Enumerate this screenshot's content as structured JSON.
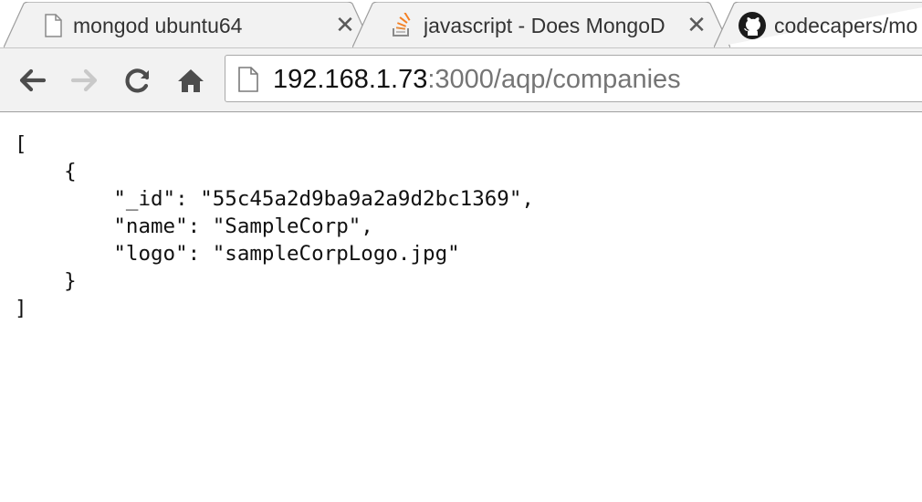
{
  "browser": {
    "tabs": [
      {
        "title": "mongod ubuntu64",
        "icon": "document-icon",
        "close": "✕"
      },
      {
        "title": "javascript - Does MongoD",
        "icon": "stackoverflow-icon",
        "close": "✕"
      },
      {
        "title": "codecapers/mo",
        "icon": "github-icon"
      }
    ],
    "address_bar": {
      "host": "192.168.1.73",
      "path": ":3000/aqp/companies"
    },
    "colors": {
      "toolbar": "#f2f2f2",
      "tab_active": "#f2f2f2",
      "tab_inactive": "#f2f2f2"
    }
  },
  "content": {
    "json_text": "[\n    {\n        \"_id\": \"55c45a2d9ba9a2a9d2bc1369\",\n        \"name\": \"SampleCorp\",\n        \"logo\": \"sampleCorpLogo.jpg\"\n    }\n]"
  }
}
